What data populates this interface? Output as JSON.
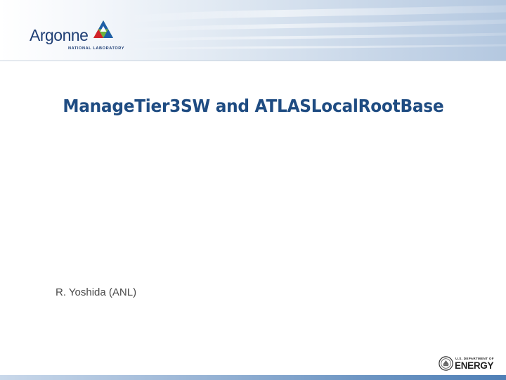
{
  "header": {
    "logo": {
      "wordmark": "Argonne",
      "subtitle": "NATIONAL LABORATORY",
      "icon": "argonne-triangle-logo-icon",
      "colors": {
        "text": "#1e3e74",
        "green": "#6fb33f",
        "blue": "#1f5fa8",
        "red": "#d2232a"
      }
    }
  },
  "slide": {
    "title": "ManageTier3SW and ATLASLocalRootBase",
    "author": "R. Yoshida (ANL)"
  },
  "footer": {
    "doe_logo": {
      "small_text": "U.S. DEPARTMENT OF",
      "big_text": "ENERGY",
      "icon": "doe-seal-icon"
    }
  },
  "colors": {
    "title": "#1f4c82",
    "author": "#4a4a4a",
    "header_gradient_end": "#b4c8e0",
    "footer_bar": "#4f7fb6"
  }
}
